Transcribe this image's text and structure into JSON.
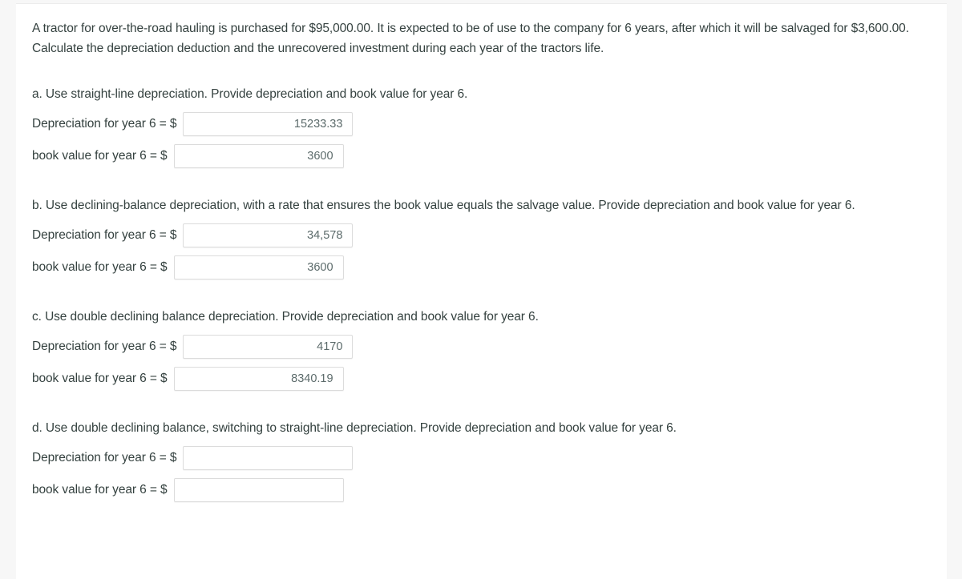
{
  "problem": {
    "intro": "A tractor for over-the-road hauling is purchased for $95,000.00. It is expected to be of use to the company for 6 years, after which it will be salvaged for $3,600.00. Calculate the depreciation deduction and the unrecovered investment during each year of the tractors life."
  },
  "common": {
    "depreciation_label": "Depreciation for year 6 = $",
    "book_value_label": "book value for year 6 = $",
    "input_placeholder": ""
  },
  "sections": [
    {
      "id": "a",
      "prompt": "a. Use straight-line depreciation. Provide depreciation and book value for year 6.",
      "depreciation_value": "15233.33",
      "book_value": "3600"
    },
    {
      "id": "b",
      "prompt": "b. Use declining-balance depreciation, with a rate that ensures the book value equals the salvage value. Provide depreciation and book value for year 6.",
      "depreciation_value": "34,578",
      "book_value": "3600"
    },
    {
      "id": "c",
      "prompt": "c. Use double declining balance depreciation. Provide depreciation and book value for year 6.",
      "depreciation_value": "4170",
      "book_value": "8340.19"
    },
    {
      "id": "d",
      "prompt": "d. Use double declining balance, switching to straight-line depreciation. Provide depreciation and book value for year 6.",
      "depreciation_value": "",
      "book_value": ""
    }
  ],
  "colors": {
    "page_background": "#f7f7f7",
    "content_background": "#ffffff",
    "text": "#34413f",
    "input_border": "#dcdcdc",
    "input_text": "#5c6b6b"
  }
}
